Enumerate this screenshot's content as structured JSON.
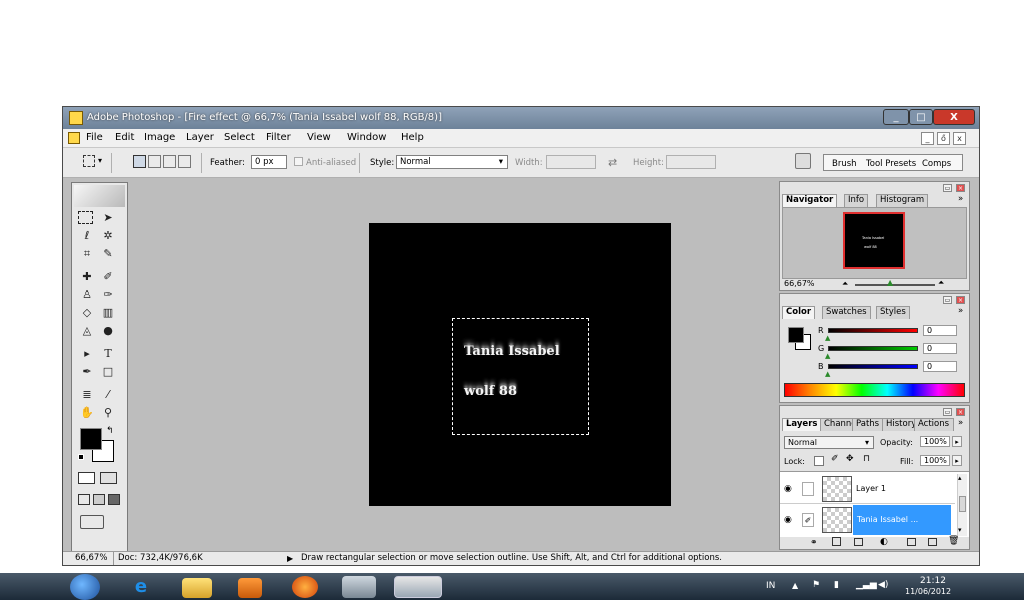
{
  "window": {
    "title": "Adobe Photoshop - [Fire effect @ 66,7% (Tania Issabel  wolf 88, RGB/8)]",
    "buttons": {
      "minimize": "_",
      "maximize": "□",
      "close": "X"
    }
  },
  "menubar": {
    "items": [
      "File",
      "Edit",
      "Image",
      "Layer",
      "Select",
      "Filter",
      "View",
      "Window",
      "Help"
    ],
    "doc_buttons": {
      "minimize": "_",
      "restore": "ő",
      "close": "x"
    }
  },
  "options": {
    "feather_label": "Feather:",
    "feather_value": "0 px",
    "anti_aliased_label": "Anti-aliased",
    "style_label": "Style:",
    "style_value": "Normal",
    "width_label": "Width:",
    "height_label": "Height:",
    "swap_icon": "⇄",
    "palette_tabs": [
      "Brush",
      "Tool Presets",
      "Comps"
    ]
  },
  "canvas": {
    "text_line1": "Tania Issabel",
    "text_line2": "wolf 88"
  },
  "status": {
    "zoom": "66,67%",
    "doc_size": "Doc: 732,4K/976,6K",
    "hint": "Draw rectangular selection or move selection outline.  Use Shift, Alt, and Ctrl for additional options."
  },
  "navigator": {
    "tabs": [
      "Navigator",
      "Info",
      "Histogram"
    ],
    "zoom": "66,67%",
    "thumb_line1": "Tania Issabel",
    "thumb_line2": "wolf 88"
  },
  "color_panel": {
    "tabs": [
      "Color",
      "Swatches",
      "Styles"
    ],
    "channels": [
      {
        "label": "R",
        "value": "0",
        "color": "#ff0000"
      },
      {
        "label": "G",
        "value": "0",
        "color": "#00cc00"
      },
      {
        "label": "B",
        "value": "0",
        "color": "#0000ff"
      }
    ]
  },
  "layers_panel": {
    "tabs": [
      "Layers",
      "Channels",
      "Paths",
      "History",
      "Actions"
    ],
    "blend_mode": "Normal",
    "opacity_label": "Opacity:",
    "opacity_value": "100%",
    "lock_label": "Lock:",
    "fill_label": "Fill:",
    "fill_value": "100%",
    "layers": [
      {
        "name": "Layer 1",
        "selected": false
      },
      {
        "name": "Tania Issabel ...",
        "selected": true
      }
    ]
  },
  "taskbar": {
    "language": "IN",
    "time": "21:12",
    "date": "11/06/2012"
  },
  "colors": {
    "title_bar": "#7a8ea5",
    "selected_layer": "#3399ff",
    "close_button": "#c9382a"
  }
}
